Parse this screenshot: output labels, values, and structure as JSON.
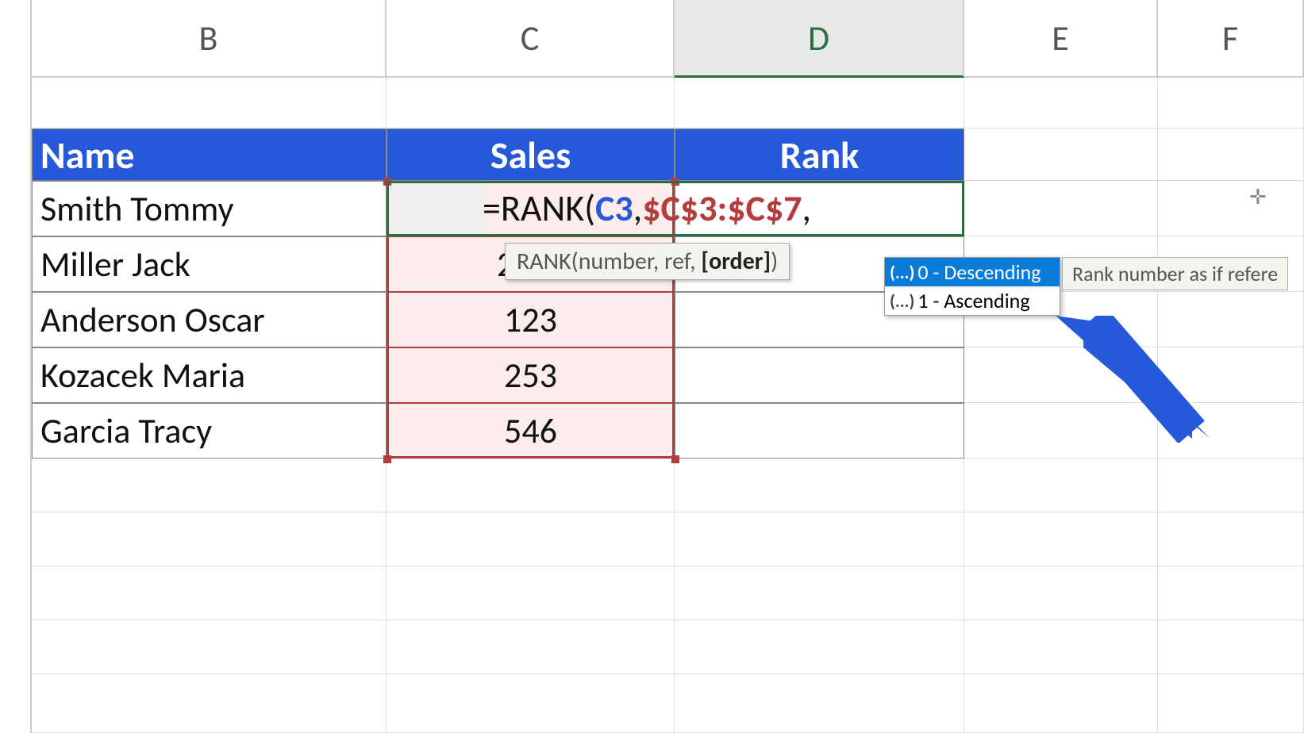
{
  "columns": {
    "B": "B",
    "C": "C",
    "D": "D",
    "E": "E",
    "F": "F"
  },
  "table": {
    "headers": {
      "name": "Name",
      "sales": "Sales",
      "rank": "Rank"
    },
    "rows": [
      {
        "name": "Smith Tommy",
        "sales": "",
        "rank_formula": true
      },
      {
        "name": "Miller Jack",
        "sales": "",
        "rank": ""
      },
      {
        "name": "Anderson Oscar",
        "sales": "123",
        "rank": ""
      },
      {
        "name": "Kozacek Maria",
        "sales": "253",
        "rank": ""
      },
      {
        "name": "Garcia Tracy",
        "sales": "546",
        "rank": ""
      }
    ],
    "partial_sales_row2": "2"
  },
  "formula": {
    "prefix": "=RANK(",
    "ref1": "C3",
    "comma1": ",",
    "ref2": "$C$3:$C$7",
    "comma2": ","
  },
  "syntax_tooltip": {
    "fn": "RANK",
    "sig_prefix": "(number, ref, ",
    "sig_bold": "[order]",
    "sig_suffix": ")"
  },
  "intellisense": {
    "options": [
      {
        "icon": "(...)",
        "label": "0 - Descending",
        "selected": true
      },
      {
        "icon": "(...)",
        "label": "1 - Ascending",
        "selected": false
      }
    ],
    "description": "Rank number as if refere"
  }
}
